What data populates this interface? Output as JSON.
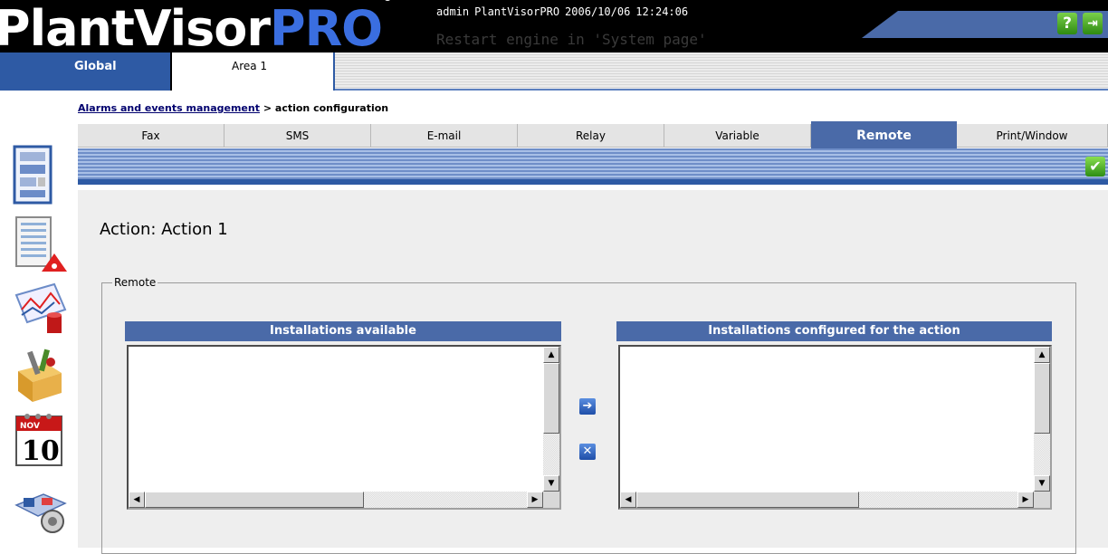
{
  "header": {
    "logo_main": "PlantVisor",
    "logo_accent": "PRO",
    "logo_mark": "®",
    "user": "admin",
    "app_name": "PlantVisorPRO",
    "date": "2006/10/06",
    "time": "12:24:06",
    "message": "Restart engine in 'System page'",
    "help_icon": "question-icon",
    "exit_icon": "exit-door-icon"
  },
  "area_tabs": [
    {
      "label": "Global",
      "selected": true
    },
    {
      "label": "Area 1",
      "selected": false
    }
  ],
  "breadcrumb": {
    "link": "Alarms and events management",
    "separator": ">",
    "current": "action configuration"
  },
  "sidebar": [
    {
      "name": "devices-icon"
    },
    {
      "name": "alarm-list-icon"
    },
    {
      "name": "graph-icon"
    },
    {
      "name": "tools-box-icon"
    },
    {
      "name": "calendar-icon",
      "month": "NOV",
      "day": "10"
    },
    {
      "name": "plant-view-icon"
    }
  ],
  "action_tabs": [
    {
      "label": "Fax",
      "active": false
    },
    {
      "label": "SMS",
      "active": false
    },
    {
      "label": "E-mail",
      "active": false
    },
    {
      "label": "Relay",
      "active": false
    },
    {
      "label": "Variable",
      "active": false
    },
    {
      "label": "Remote",
      "active": true
    },
    {
      "label": "Print/Window",
      "active": false
    }
  ],
  "toolbar": {
    "save_icon": "checkmark-icon"
  },
  "main": {
    "action_title": "Action: Action 1",
    "fieldset_legend": "Remote",
    "available_header": "Installations available",
    "configured_header": "Installations configured for the action",
    "available_items": [],
    "configured_items": []
  },
  "colors": {
    "header_bg": "#000000",
    "accent_blue": "#4a6aa8",
    "tab_active": "#2e5aa4",
    "content_bg": "#eeeeee"
  }
}
